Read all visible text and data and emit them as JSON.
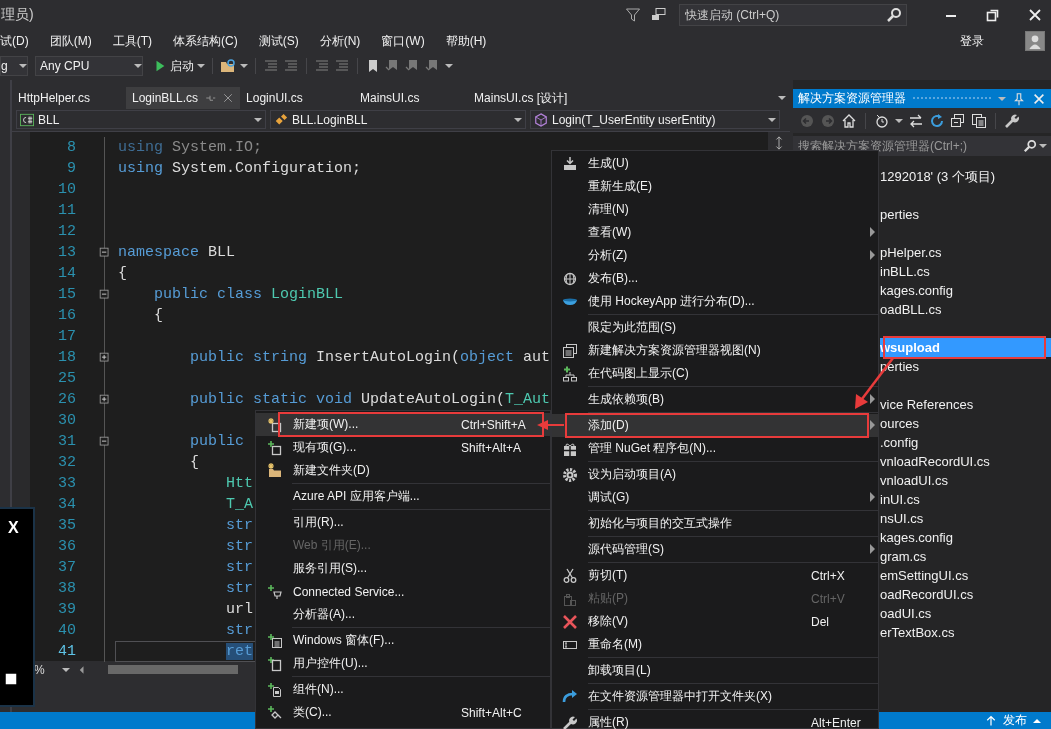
{
  "window": {
    "title": "理员)",
    "quick_launch": {
      "placeholder": "快速启动 (Ctrl+Q)"
    }
  },
  "menu_bar": {
    "items": [
      "试(D)",
      "团队(M)",
      "工具(T)",
      "体系结构(C)",
      "测试(S)",
      "分析(N)",
      "窗口(W)",
      "帮助(H)"
    ],
    "sign_in": "登录"
  },
  "toolbar": {
    "configuration": "g",
    "platform": "Any CPU",
    "start_button": "启动"
  },
  "editor": {
    "tabs": [
      {
        "label": "HttpHelper.cs",
        "selected": false
      },
      {
        "label": "LoginBLL.cs",
        "selected": true
      },
      {
        "label": "LoginUI.cs",
        "selected": false
      },
      {
        "label": "MainsUI.cs",
        "selected": false
      },
      {
        "label": "MainsUI.cs [设计]",
        "selected": false
      }
    ],
    "nav": {
      "project": "BLL",
      "class": "BLL.LoginBLL",
      "member": "Login(T_UserEntity userEntity)"
    },
    "lines": [
      {
        "number": "8",
        "selected": false,
        "tokens": [
          {
            "kind": "faded_keyword",
            "text": "using"
          },
          {
            "kind": "faded",
            "text": " System.IO;"
          }
        ]
      },
      {
        "number": "9",
        "selected": false,
        "tokens": [
          {
            "kind": "keyword",
            "text": "using"
          },
          {
            "kind": "plain",
            "text": " System.Configuration;"
          }
        ]
      },
      {
        "number": "10",
        "selected": false
      },
      {
        "number": "11",
        "selected": false
      },
      {
        "number": "12",
        "selected": false
      },
      {
        "number": "13",
        "selected": false,
        "collapsed": false,
        "tokens": [
          {
            "kind": "keyword",
            "text": "namespace"
          },
          {
            "kind": "plain",
            "text": " BLL"
          }
        ]
      },
      {
        "number": "14",
        "selected": false,
        "tokens": [
          {
            "kind": "plain",
            "text": "{"
          }
        ]
      },
      {
        "number": "15",
        "selected": false,
        "collapsed": false,
        "tokens": [
          {
            "kind": "keyword",
            "text": "    public class "
          },
          {
            "kind": "type",
            "text": "LoginBLL"
          }
        ]
      },
      {
        "number": "16",
        "selected": false,
        "tokens": [
          {
            "kind": "plain",
            "text": "    {"
          }
        ]
      },
      {
        "number": "17",
        "selected": false
      },
      {
        "number": "18",
        "selected": false,
        "collapsed": true,
        "tokens": [
          {
            "kind": "keyword",
            "text": "        public string"
          },
          {
            "kind": "plain",
            "text": " InsertAutoLogin("
          },
          {
            "kind": "keyword",
            "text": "object"
          },
          {
            "kind": "plain",
            "text": " aut"
          }
        ]
      },
      {
        "number": "25",
        "selected": false
      },
      {
        "number": "26",
        "selected": false,
        "collapsed": true,
        "tokens": [
          {
            "kind": "keyword",
            "text": "        public static void"
          },
          {
            "kind": "plain",
            "text": " UpdateAutoLogin("
          },
          {
            "kind": "type",
            "text": "T_Aut"
          }
        ]
      },
      {
        "number": "30",
        "selected": false
      },
      {
        "number": "31",
        "selected": false,
        "collapsed": false,
        "tokens": [
          {
            "kind": "keyword",
            "text": "        public"
          }
        ]
      },
      {
        "number": "32",
        "selected": false,
        "tokens": [
          {
            "kind": "plain",
            "text": "        {"
          }
        ]
      },
      {
        "number": "33",
        "selected": false,
        "tokens": [
          {
            "kind": "type",
            "text": "            Htt"
          }
        ]
      },
      {
        "number": "34",
        "selected": false,
        "tokens": [
          {
            "kind": "type",
            "text": "            T_A"
          }
        ]
      },
      {
        "number": "35",
        "selected": false,
        "tokens": [
          {
            "kind": "keyword",
            "text": "            str"
          }
        ]
      },
      {
        "number": "36",
        "selected": false,
        "tokens": [
          {
            "kind": "keyword",
            "text": "            str"
          }
        ]
      },
      {
        "number": "37",
        "selected": false,
        "tokens": [
          {
            "kind": "keyword",
            "text": "            str"
          }
        ]
      },
      {
        "number": "38",
        "selected": false,
        "tokens": [
          {
            "kind": "keyword",
            "text": "            str"
          }
        ]
      },
      {
        "number": "39",
        "selected": false,
        "tokens": [
          {
            "kind": "plain",
            "text": "            url"
          }
        ]
      },
      {
        "number": "40",
        "selected": false,
        "tokens": [
          {
            "kind": "keyword",
            "text": "            str"
          }
        ]
      },
      {
        "number": "41",
        "selected": true,
        "tokens": [
          {
            "kind": "keyword",
            "text": "            ret"
          }
        ]
      }
    ],
    "zoom": "%"
  },
  "solution_explorer": {
    "title": "解决方案资源管理器",
    "search": {
      "placeholder": "搜索解决方案资源管理器(Ctrl+;)"
    },
    "groups": [
      {
        "items": [
          {
            "label": "1292018' (3 个项目)",
            "selected": false
          }
        ]
      },
      {
        "items": [
          {
            "label": "perties",
            "selected": false
          }
        ]
      },
      {
        "items": [
          {
            "label": "pHelper.cs",
            "selected": false
          },
          {
            "label": "inBLL.cs",
            "selected": false
          },
          {
            "label": "kages.config",
            "selected": false
          },
          {
            "label": "oadBLL.cs",
            "selected": false
          }
        ]
      },
      {
        "items": [
          {
            "label": "wsupload",
            "selected": true,
            "annotated": true
          },
          {
            "label": "perties",
            "selected": false
          }
        ]
      },
      {
        "items": [
          {
            "label": "vice References",
            "selected": false
          },
          {
            "label": "ources",
            "selected": false
          },
          {
            "label": ".config",
            "selected": false
          },
          {
            "label": "vnloadRecordUI.cs",
            "selected": false
          },
          {
            "label": "vnloadUI.cs",
            "selected": false
          },
          {
            "label": "inUI.cs",
            "selected": false
          },
          {
            "label": "nsUI.cs",
            "selected": false
          },
          {
            "label": "kages.config",
            "selected": false
          },
          {
            "label": "gram.cs",
            "selected": false
          },
          {
            "label": "emSettingUI.cs",
            "selected": false
          },
          {
            "label": "oadRecordUI.cs",
            "selected": false
          },
          {
            "label": "oadUI.cs",
            "selected": false
          },
          {
            "label": "erTextBox.cs",
            "selected": false
          }
        ]
      }
    ]
  },
  "context_menu": {
    "groups": [
      {
        "items": [
          {
            "label": "生成(U)",
            "has_submenu": false,
            "selected": false,
            "disabled": false
          },
          {
            "label": "重新生成(E)",
            "has_submenu": false,
            "selected": false,
            "disabled": false
          },
          {
            "label": "清理(N)",
            "has_submenu": false,
            "selected": false,
            "disabled": false
          },
          {
            "label": "查看(W)",
            "has_submenu": true,
            "selected": false,
            "disabled": false
          },
          {
            "label": "分析(Z)",
            "has_submenu": true,
            "selected": false,
            "disabled": false
          },
          {
            "label": "发布(B)...",
            "has_submenu": false,
            "selected": false,
            "disabled": false
          },
          {
            "label": "使用 HockeyApp 进行分布(D)...",
            "has_submenu": false,
            "selected": false,
            "disabled": false
          }
        ]
      },
      {
        "items": [
          {
            "label": "限定为此范围(S)",
            "has_submenu": false,
            "selected": false,
            "disabled": false
          },
          {
            "label": "新建解决方案资源管理器视图(N)",
            "has_submenu": false,
            "selected": false,
            "disabled": false
          },
          {
            "label": "在代码图上显示(C)",
            "has_submenu": false,
            "selected": false,
            "disabled": false
          }
        ]
      },
      {
        "items": [
          {
            "label": "生成依赖项(B)",
            "has_submenu": true,
            "selected": false,
            "disabled": false
          }
        ]
      },
      {
        "items": [
          {
            "label": "添加(D)",
            "has_submenu": true,
            "selected": true,
            "disabled": false,
            "annotated": true
          },
          {
            "label": "管理 NuGet 程序包(N)...",
            "has_submenu": false,
            "selected": false,
            "disabled": false
          }
        ]
      },
      {
        "items": [
          {
            "label": "设为启动项目(A)",
            "has_submenu": false,
            "selected": false,
            "disabled": false
          },
          {
            "label": "调试(G)",
            "has_submenu": true,
            "selected": false,
            "disabled": false
          }
        ]
      },
      {
        "items": [
          {
            "label": "初始化与项目的交互式操作",
            "has_submenu": false,
            "selected": false,
            "disabled": false
          }
        ]
      },
      {
        "items": [
          {
            "label": "源代码管理(S)",
            "has_submenu": true,
            "selected": false,
            "disabled": false
          }
        ]
      },
      {
        "items": [
          {
            "label": "剪切(T)",
            "shortcut": "Ctrl+X",
            "has_submenu": false,
            "selected": false,
            "disabled": false
          },
          {
            "label": "粘贴(P)",
            "shortcut": "Ctrl+V",
            "has_submenu": false,
            "selected": false,
            "disabled": true
          },
          {
            "label": "移除(V)",
            "shortcut": "Del",
            "has_submenu": false,
            "selected": false,
            "disabled": false
          },
          {
            "label": "重命名(M)",
            "has_submenu": false,
            "selected": false,
            "disabled": false
          }
        ]
      },
      {
        "items": [
          {
            "label": "卸载项目(L)",
            "has_submenu": false,
            "selected": false,
            "disabled": false
          }
        ]
      },
      {
        "items": [
          {
            "label": "在文件资源管理器中打开文件夹(X)",
            "has_submenu": false,
            "selected": false,
            "disabled": false
          }
        ]
      },
      {
        "items": [
          {
            "label": "属性(R)",
            "shortcut": "Alt+Enter",
            "has_submenu": false,
            "selected": false,
            "disabled": false
          }
        ]
      }
    ]
  },
  "add_submenu": {
    "groups": [
      {
        "items": [
          {
            "label": "新建项(W)...",
            "shortcut": "Ctrl+Shift+A",
            "selected": true,
            "disabled": false,
            "annotated": true
          },
          {
            "label": "现有项(G)...",
            "shortcut": "Shift+Alt+A",
            "selected": false,
            "disabled": false
          },
          {
            "label": "新建文件夹(D)",
            "selected": false,
            "disabled": false
          }
        ]
      },
      {
        "items": [
          {
            "label": "Azure API 应用客户端...",
            "selected": false,
            "disabled": false
          }
        ]
      },
      {
        "items": [
          {
            "label": "引用(R)...",
            "selected": false,
            "disabled": false
          },
          {
            "label": "Web 引用(E)...",
            "selected": false,
            "disabled": true
          },
          {
            "label": "服务引用(S)...",
            "selected": false,
            "disabled": false
          },
          {
            "label": "Connected Service...",
            "selected": false,
            "disabled": false
          },
          {
            "label": "分析器(A)...",
            "selected": false,
            "disabled": false
          }
        ]
      },
      {
        "items": [
          {
            "label": "Windows 窗体(F)...",
            "selected": false,
            "disabled": false
          },
          {
            "label": "用户控件(U)...",
            "selected": false,
            "disabled": false
          }
        ]
      },
      {
        "items": [
          {
            "label": "组件(N)...",
            "selected": false,
            "disabled": false
          },
          {
            "label": "类(C)...",
            "shortcut": "Shift+Alt+C",
            "selected": false,
            "disabled": false
          }
        ]
      }
    ]
  },
  "output_popup": {
    "close": "X"
  },
  "status_bar": {
    "publish": "发布"
  }
}
